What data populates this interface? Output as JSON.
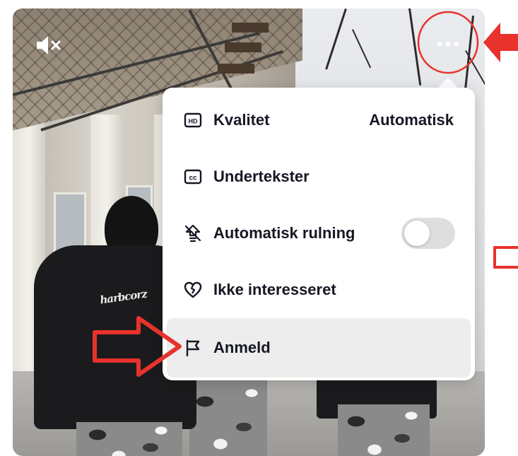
{
  "video": {
    "jacket_print": "harbcorz",
    "mute_icon": "speaker-muted-icon",
    "more_icon": "more-dots-icon"
  },
  "menu": {
    "items": [
      {
        "icon": "hd-icon",
        "label": "Kvalitet",
        "value": "Automatisk"
      },
      {
        "icon": "cc-icon",
        "label": "Undertekster"
      },
      {
        "icon": "autoscroll-icon",
        "label": "Automatisk rulning",
        "toggle_on": false
      },
      {
        "icon": "broken-heart-icon",
        "label": "Ikke interesseret"
      },
      {
        "icon": "flag-icon",
        "label": "Anmeld",
        "highlighted": true
      }
    ]
  },
  "annotations": {
    "color": "#e8322c",
    "items": [
      "circle-around-more-button",
      "arrow-pointing-left-at-more-button",
      "arrow-pointing-right-at-anmeld",
      "bracket-marker-right"
    ]
  }
}
